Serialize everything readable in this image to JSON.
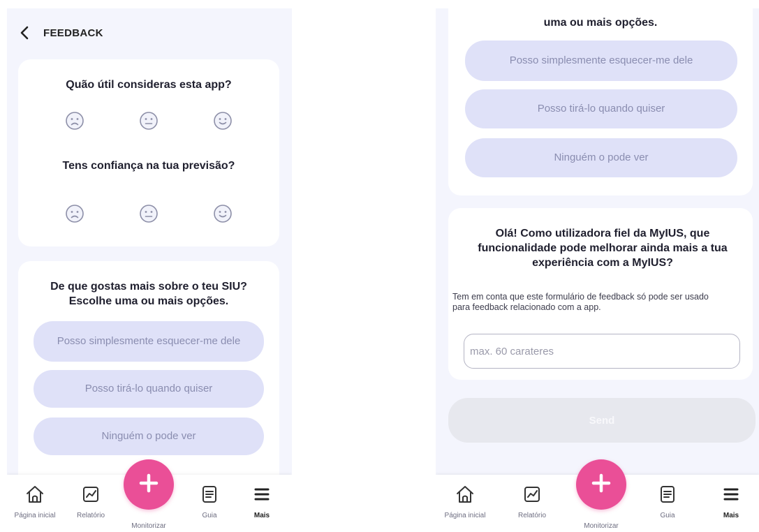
{
  "left": {
    "header": {
      "title": "FEEDBACK"
    },
    "rating": {
      "q1": "Quão útil consideras esta app?",
      "q2": "Tens confiança na tua previsão?"
    },
    "likes": {
      "question": "De que gostas mais sobre o teu SIU? Escolhe uma ou mais opções.",
      "options": [
        "Posso simplesmente esquecer-me dele",
        "Posso tirá-lo quando quiser",
        "Ninguém o pode ver"
      ]
    }
  },
  "right": {
    "likes": {
      "question_tail": "uma ou mais opções.",
      "options": [
        "Posso simplesmente esquecer-me dele",
        "Posso tirá-lo quando quiser",
        "Ninguém o pode ver"
      ]
    },
    "improve": {
      "question": "Olá! Como utilizadora fiel da MyIUS, que funcionalidade pode melhorar ainda mais a tua experiência com a MyIUS?",
      "helper": "Tem em conta que este formulário de feedback só pode ser usado para feedback relacionado com a app.",
      "input_placeholder": "max. 60 carateres",
      "input_value": ""
    },
    "send_label": "Send"
  },
  "nav": {
    "home": "Página inicial",
    "report": "Relatório",
    "monitor": "Monitorizar",
    "guide": "Guia",
    "more": "Mais"
  },
  "icons": {
    "back": "chevron-left-icon",
    "sad": "sad-face-icon",
    "neutral": "neutral-face-icon",
    "happy": "happy-face-icon",
    "home": "home-icon",
    "report": "chart-icon",
    "monitor": "plus-icon",
    "guide": "document-icon",
    "more": "menu-icon"
  },
  "colors": {
    "accent": "#ea4f97",
    "option_bg": "#dfe1f8",
    "background": "#f4f5fd"
  }
}
